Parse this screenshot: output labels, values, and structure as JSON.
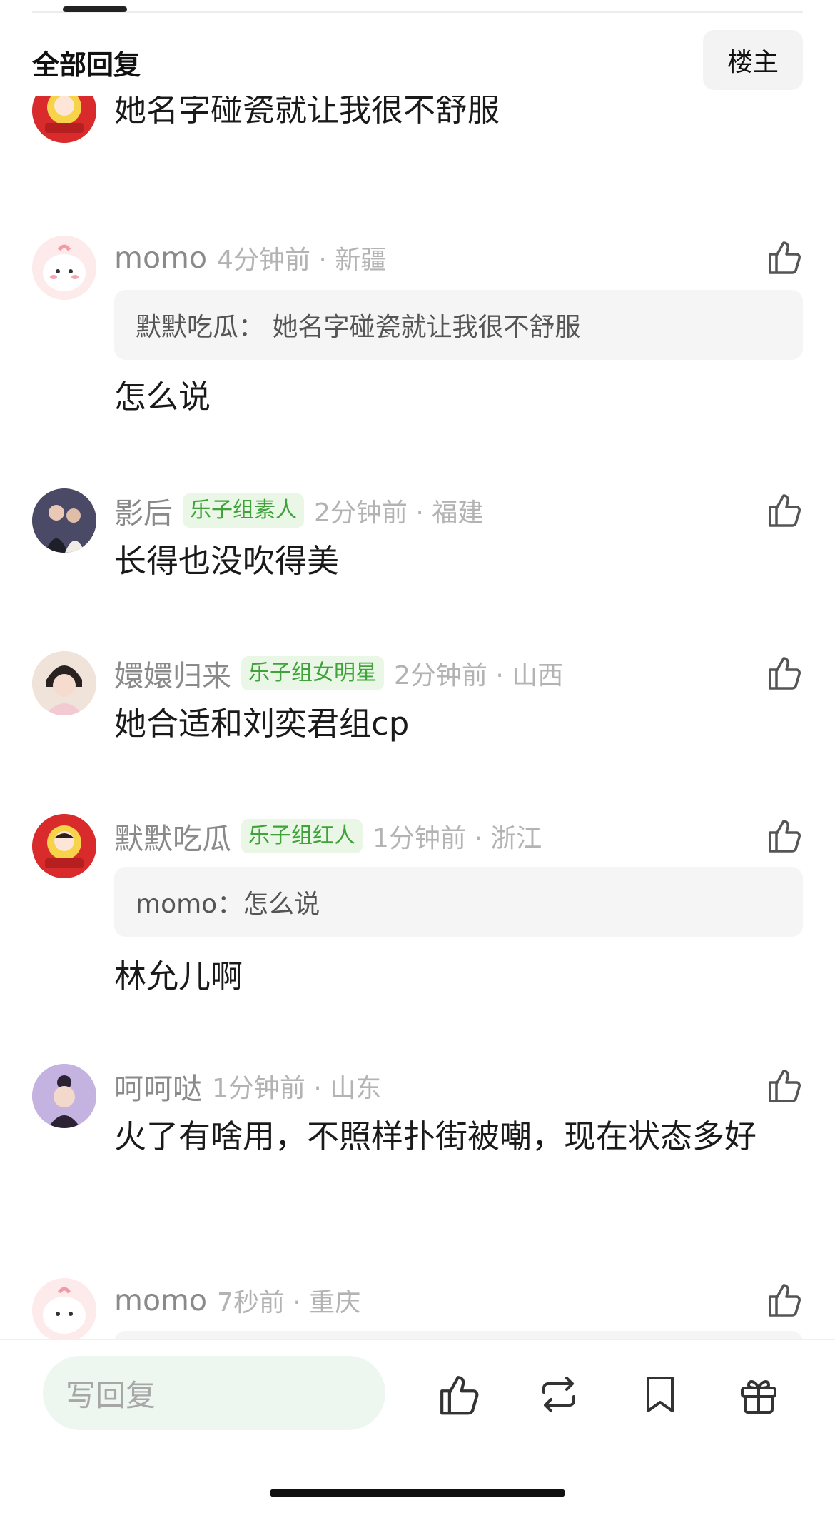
{
  "header": {
    "title": "全部回复",
    "owner_button": "楼主"
  },
  "partial_comment": {
    "content": "她名字碰瓷就让我很不舒服"
  },
  "comments": [
    {
      "user": "momo",
      "badge": "",
      "time": "4分钟前 · 新疆",
      "quote": "默默吃瓜： 她名字碰瓷就让我很不舒服",
      "content": "怎么说"
    },
    {
      "user": "影后",
      "badge": "乐子组素人",
      "time": "2分钟前 · 福建",
      "quote": "",
      "content": "长得也没吹得美"
    },
    {
      "user": "嬛嬛归来",
      "badge": "乐子组女明星",
      "time": "2分钟前 · 山西",
      "quote": "",
      "content": "她合适和刘奕君组cp"
    },
    {
      "user": "默默吃瓜",
      "badge": "乐子组红人",
      "time": "1分钟前 · 浙江",
      "quote": "momo：怎么说",
      "content": "林允儿啊"
    },
    {
      "user": "呵呵哒",
      "badge": "",
      "time": "1分钟前 · 山东",
      "quote": "",
      "content": "火了有啥用，不照样扑街被嘲，现在状态多好"
    },
    {
      "user": "momo",
      "badge": "",
      "time": "7秒前 · 重庆",
      "quote": "",
      "content": ""
    }
  ],
  "bottom_bar": {
    "reply_placeholder": "写回复",
    "actions": [
      "like-icon",
      "repost-icon",
      "bookmark-icon",
      "gift-icon"
    ]
  },
  "colors": {
    "badge_bg": "#eaf7e6",
    "badge_text": "#3fa33a",
    "muted": "#8a8a8a",
    "time": "#b3b3b3"
  }
}
